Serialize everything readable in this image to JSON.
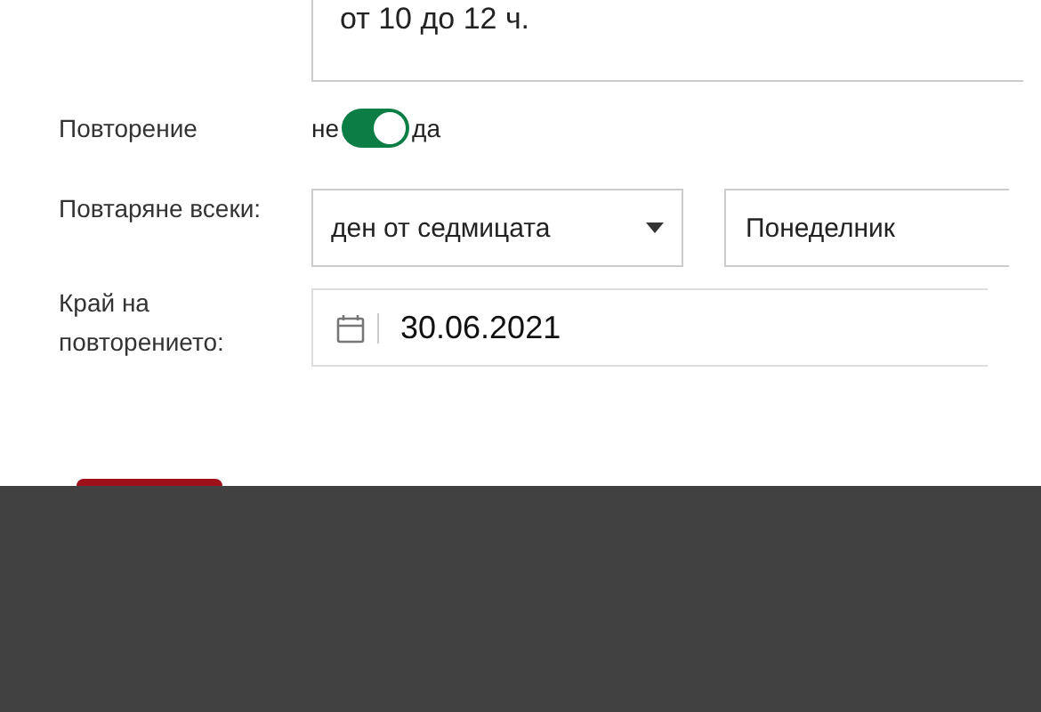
{
  "note": {
    "value": "от 10 до 12 ч."
  },
  "repeat": {
    "label": "Повторение",
    "off_label": "не",
    "on_label": "да",
    "on": true
  },
  "repeat_every": {
    "label": "Повтаряне всеки:",
    "unit": "ден от седмицата",
    "day": "Понеделник"
  },
  "repeat_end": {
    "label": "Край на повторението:",
    "date": "30.06.2021"
  },
  "overlay": {
    "kind": "dark"
  }
}
